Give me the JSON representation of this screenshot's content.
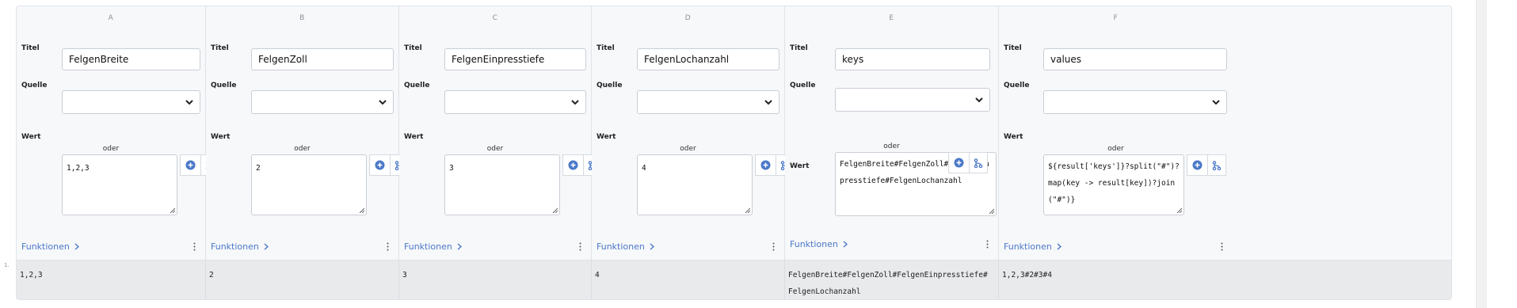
{
  "labels": {
    "titel": "Titel",
    "quelle": "Quelle",
    "oder": "oder",
    "wert": "Wert",
    "funktionen": "Funktionen"
  },
  "columns": [
    {
      "letter": "A",
      "title": "FelgenBreite",
      "source": "",
      "value": "1,2,3"
    },
    {
      "letter": "B",
      "title": "FelgenZoll",
      "source": "",
      "value": "2"
    },
    {
      "letter": "C",
      "title": "FelgenEinpresstiefe",
      "source": "",
      "value": "3"
    },
    {
      "letter": "D",
      "title": "FelgenLochanzahl",
      "source": "",
      "value": "4"
    },
    {
      "letter": "E",
      "title": "keys",
      "source": "",
      "value": "FelgenBreite#FelgenZoll#FelgenEinpresstiefe#FelgenLochanzahl"
    },
    {
      "letter": "F",
      "title": "values",
      "source": "",
      "value": "${result['keys']}?split(\"#\")?map(key -> result[key])?join(\"#\")}"
    }
  ],
  "result_row": {
    "number": "1.",
    "cells": [
      "1,2,3",
      "2",
      "3",
      "4",
      "FelgenBreite#FelgenZoll#FelgenEinpresstiefe#FelgenLochanzahl",
      "1,2,3#2#3#4"
    ]
  },
  "icons": {
    "select": "chevron-down-icon",
    "add": "plus-circle-icon",
    "branch": "branch-icon",
    "more": "more-vertical-icon",
    "next": "chevron-right-icon"
  },
  "colors": {
    "accent": "#4a78c8",
    "background": "#f7f8fa",
    "result_background": "#e9eaec"
  }
}
